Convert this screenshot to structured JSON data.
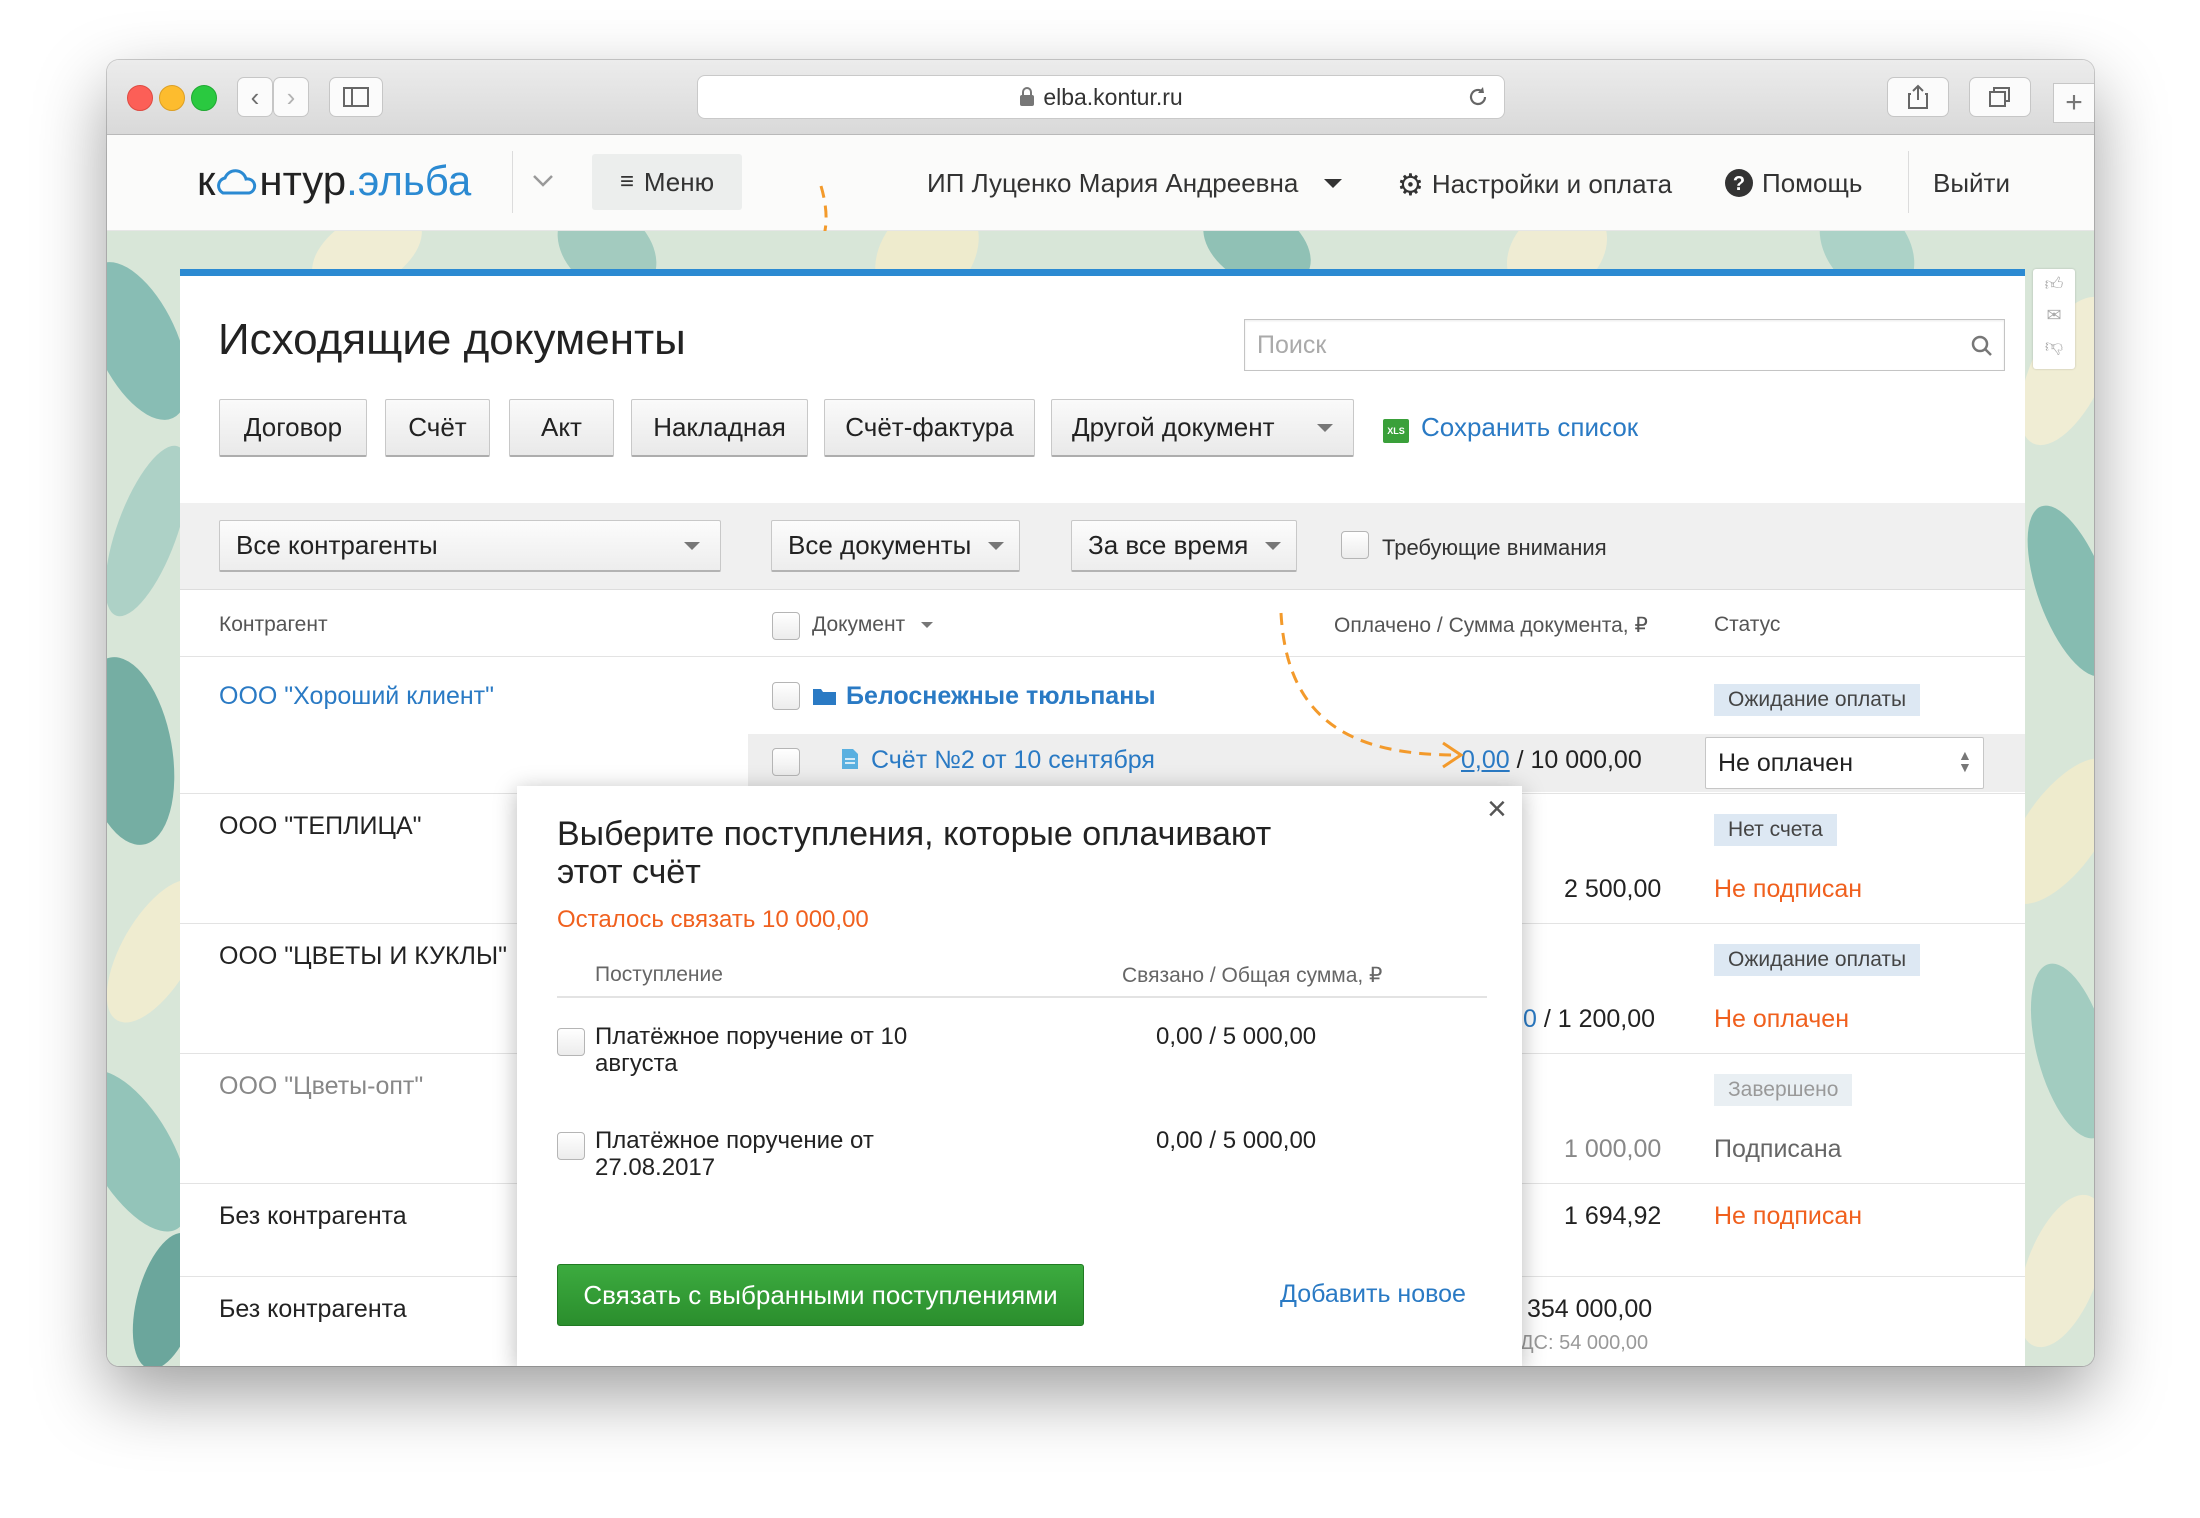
{
  "browser": {
    "url": "elba.kontur.ru"
  },
  "header": {
    "logo_part1": "к",
    "logo_part2": "нтур",
    "logo_dot": ".",
    "logo_part3": "эльба",
    "menu_label": "Меню",
    "account_name": "ИП Луценко Мария Андреевна",
    "settings_label": "Настройки и оплата",
    "help_label": "Помощь",
    "logout_label": "Выйти"
  },
  "page": {
    "title": "Исходящие документы",
    "search_placeholder": "Поиск"
  },
  "toolbar": {
    "buttons": [
      "Договор",
      "Счёт",
      "Акт",
      "Накладная",
      "Счёт-фактура",
      "Другой документ"
    ],
    "save_list_icon": "XLS",
    "save_list_label": "Сохранить список"
  },
  "filters": {
    "counterparty": "Все контрагенты",
    "documents": "Все документы",
    "period": "За все время",
    "attention_label": "Требующие внимания"
  },
  "columns": {
    "counterparty": "Контрагент",
    "document": "Документ",
    "paid_total": "Оплачено / Сумма документа, ₽",
    "status": "Статус"
  },
  "rows": [
    {
      "counterparty": "ООО \"Хороший клиент\"",
      "folder": "Белоснежные тюльпаны",
      "badge": "Ожидание оплаты",
      "doc": "Счёт №2 от 10 сентября",
      "paid": "0,00",
      "total": " / 10 000,00",
      "status_select": "Не оплачен"
    },
    {
      "counterparty": "ООО \"ТЕПЛИЦА\"",
      "badge": "Нет счета",
      "amount": "2 500,00",
      "status": "Не подписан"
    },
    {
      "counterparty": "ООО \"ЦВЕТЫ И КУКЛЫ\"",
      "badge": "Ожидание оплаты",
      "amount_prefix": "0",
      "amount": " / 1 200,00",
      "status": "Не оплачен"
    },
    {
      "counterparty": "ООО \"Цветы-опт\"",
      "badge": "Завершено",
      "amount": "1 000,00",
      "status": "Подписана"
    },
    {
      "counterparty": "Без контрагента",
      "amount": "1 694,92",
      "status": "Не подписан"
    },
    {
      "counterparty": "Без контрагента",
      "amount": "354 000,00",
      "vat": "ДС: 54 000,00"
    }
  ],
  "modal": {
    "title_line1": "Выберите поступления, которые оплачивают",
    "title_line2": "этот счёт",
    "remaining": "Осталось связать 10 000,00",
    "col_receipt": "Поступление",
    "col_linked": "Связано  / Общая сумма, ₽",
    "items": [
      {
        "line1": "Платёжное поручение от 10",
        "line2": "августа",
        "amount": "0,00  / 5 000,00"
      },
      {
        "line1": "Платёжное поручение от",
        "line2": "27.08.2017",
        "amount": "0,00  / 5 000,00"
      }
    ],
    "link_button": "Связать с выбранными поступлениями",
    "add_new": "Добавить новое"
  },
  "colors": {
    "accent_blue": "#2b8ad2",
    "link": "#2a7ac4",
    "warning_orange": "#f0601e",
    "green_button": "#2f9a31",
    "arrow_orange": "#f39a2b"
  }
}
